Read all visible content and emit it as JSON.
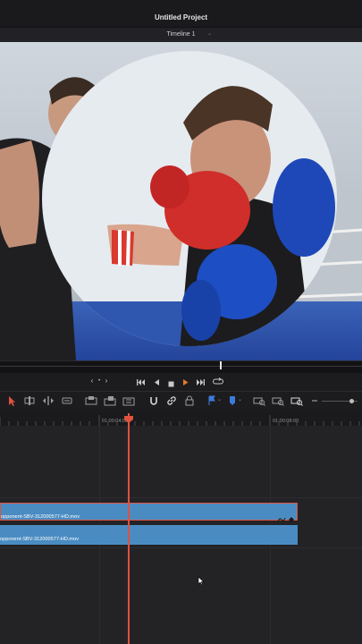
{
  "app": {
    "project_title": "Untitled Project",
    "timeline_name": "Timeline 1"
  },
  "viewer": {
    "content": "boxing-video-frame"
  },
  "transport": {
    "prev_label": "‹",
    "dot_label": "•",
    "next_label": "›"
  },
  "ruler": {
    "timecodes": [
      "01:00:04:00",
      "01:00:08:00"
    ]
  },
  "clips": {
    "video_clip_name": "opponent-SBV-312000577-HD.mov",
    "audio_clip_name": "opponent-SBV-312000577-HD.mov"
  },
  "colors": {
    "accent": "#e0523f",
    "clip_blue": "#4a8cc2",
    "toolbar_blue": "#3d7bd9",
    "selected_border": "#e0523f"
  },
  "icons": [
    "select-arrow-icon",
    "trim-icon",
    "dynamic-trim-icon",
    "blade-icon",
    "insert-clip-icon",
    "overwrite-clip-icon",
    "replace-clip-icon",
    "snapping-icon",
    "linked-selection-icon",
    "position-lock-icon",
    "flag-icon",
    "marker-icon",
    "zoom-full-icon",
    "zoom-detail-icon",
    "zoom-custom-icon",
    "zoom-out-icon"
  ]
}
